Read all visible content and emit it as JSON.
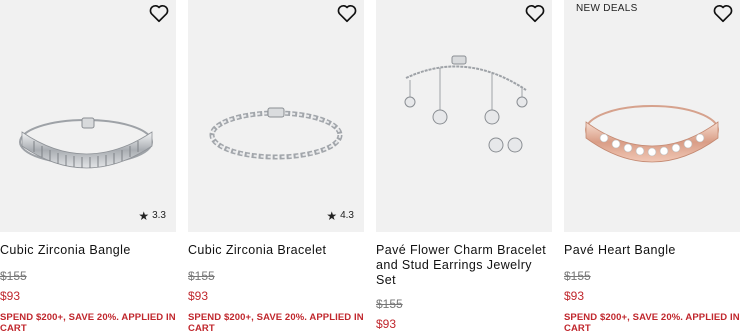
{
  "products": [
    {
      "title": "Cubic Zirconia Bangle",
      "old_price": "$155",
      "new_price": "$93",
      "rating": "3.3",
      "promo": "SPEND $200+, SAVE 20%. APPLIED IN CART",
      "icon": "heart-icon"
    },
    {
      "title": "Cubic Zirconia Bracelet",
      "old_price": "$155",
      "new_price": "$93",
      "rating": "4.3",
      "promo": "SPEND $200+, SAVE 20%. APPLIED IN CART",
      "icon": "heart-icon"
    },
    {
      "title": "Pavé Flower Charm Bracelet and Stud Earrings Jewelry Set",
      "old_price": "$155",
      "new_price": "$93",
      "icon": "heart-icon"
    },
    {
      "badge": "NEW DEALS",
      "title": "Pavé Heart Bangle",
      "old_price": "$155",
      "new_price": "$93",
      "promo": "SPEND $200+, SAVE 20%. APPLIED IN CART",
      "icon": "heart-icon"
    }
  ],
  "colors": {
    "sale_red": "#c0272d",
    "image_bg": "#f1f1f1",
    "silver": "#c9ccd0",
    "rose_gold": "#e6b9a6"
  }
}
